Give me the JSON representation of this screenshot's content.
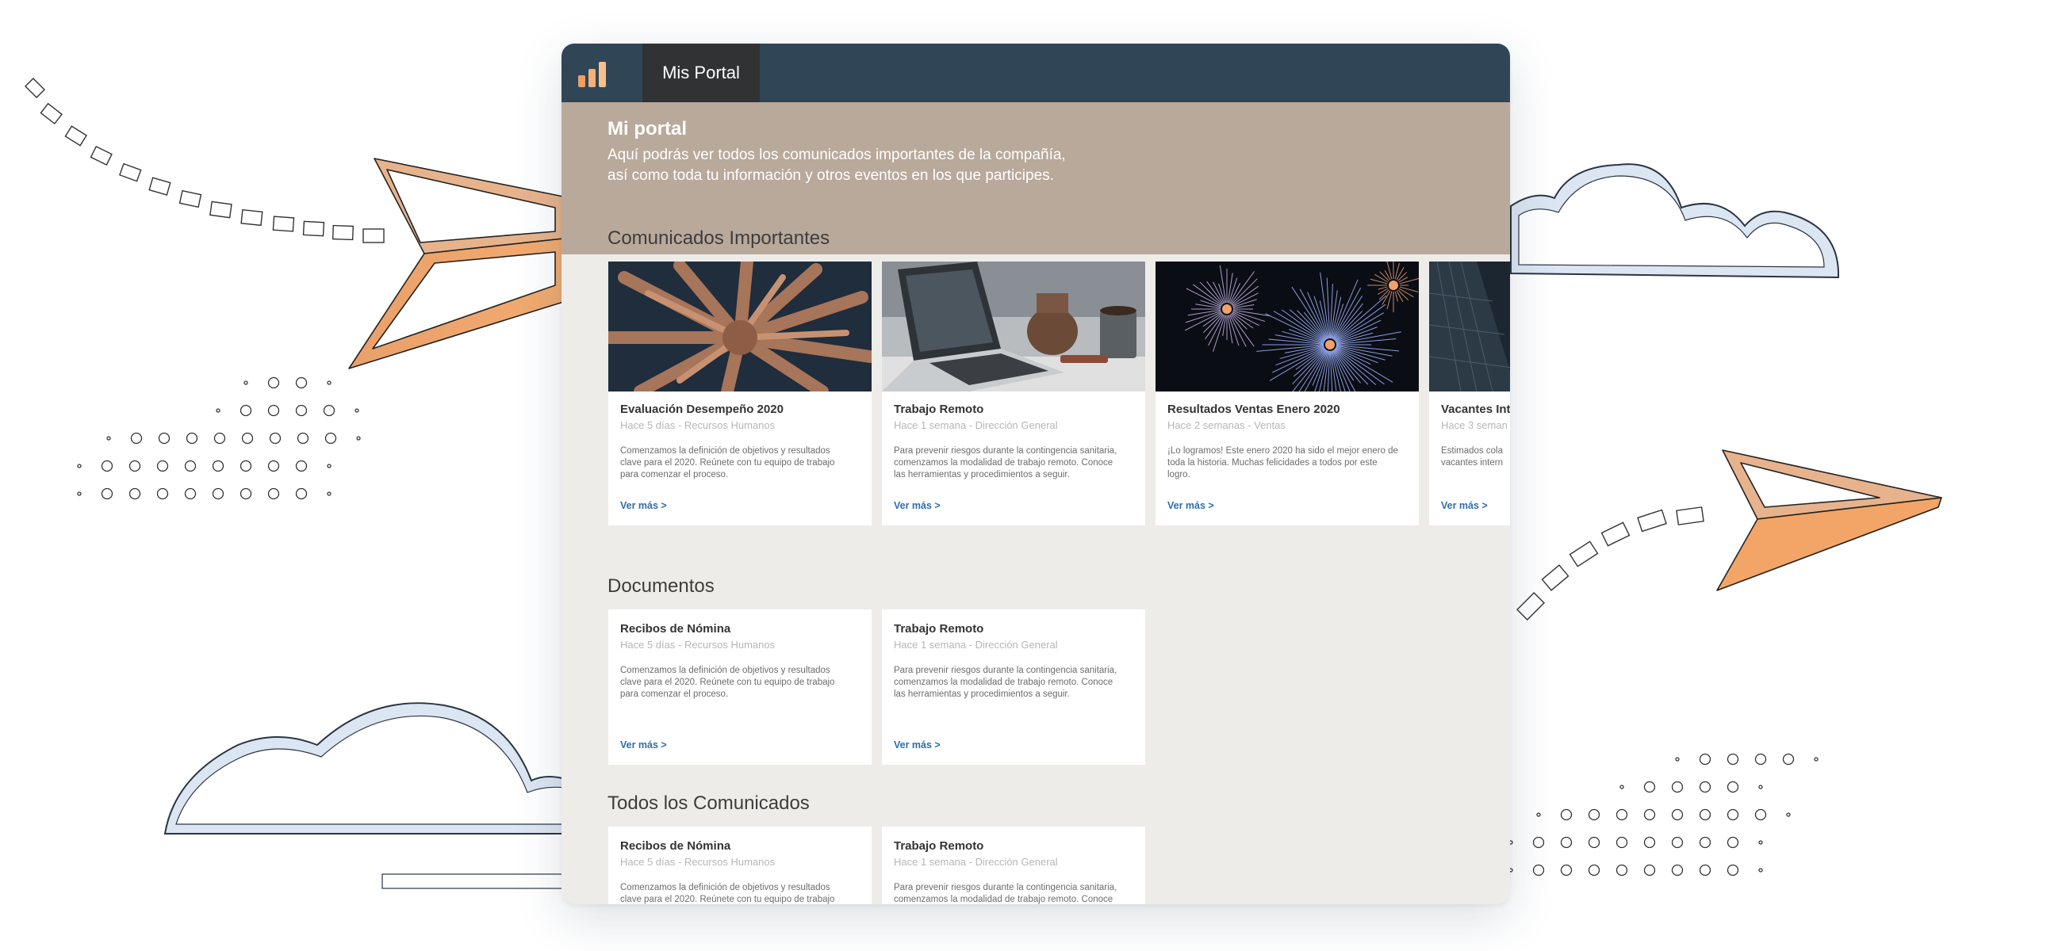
{
  "colors": {
    "topbar": "#304656",
    "tab_active": "#303234",
    "hero": "#b9a99b",
    "content_bg": "#eeece8",
    "link": "#2f6ea6",
    "accent_orange": "#f0a060"
  },
  "header": {
    "logo_icon": "bar-chart-logo-icon",
    "tab_label": "Mis Portal"
  },
  "hero": {
    "title": "Mi portal",
    "line1": "Aquí podrás ver todos los comunicados importantes de la compañía,",
    "line2": "así como toda tu información y otros eventos en los que participes."
  },
  "sections": {
    "important": {
      "title": "Comunicados Importantes",
      "cards": [
        {
          "image": "team-hands-photo",
          "title": "Evaluación Desempeño 2020",
          "meta": "Hace 5 días - Recursos Humanos",
          "desc": "Comenzamos la definición de objetivos y resultados clave para el 2020. Reúnete con tu equipo de trabajo para comenzar el proceso.",
          "link": "Ver más >"
        },
        {
          "image": "laptop-coffee-photo",
          "title": "Trabajo Remoto",
          "meta": "Hace 1 semana - Dirección General",
          "desc": "Para prevenir riesgos durante la contingencia sanitaria, comenzamos la modalidad de trabajo remoto. Conoce las herramientas y procedimientos a seguir.",
          "link": "Ver más >"
        },
        {
          "image": "fireworks-photo",
          "title": "Resultados Ventas Enero 2020",
          "meta": "Hace 2 semanas - Ventas",
          "desc": "¡Lo logramos! Este enero 2020 ha sido el mejor enero de toda la historia. Muchas felicidades a todos por este logro.",
          "link": "Ver más >"
        },
        {
          "image": "office-building-photo",
          "title": "Vacantes Int",
          "meta": "Hace 3 seman",
          "desc": "Estimados cola vacantes intern",
          "link": "Ver más >"
        }
      ]
    },
    "documents": {
      "title": "Documentos",
      "cards": [
        {
          "title": "Recibos de Nómina",
          "meta": "Hace 5 días - Recursos Humanos",
          "desc": "Comenzamos la definición de objetivos y resultados clave para el 2020. Reúnete con tu equipo de trabajo para comenzar el proceso.",
          "link": "Ver más >"
        },
        {
          "title": "Trabajo Remoto",
          "meta": "Hace 1 semana - Dirección General",
          "desc": "Para prevenir riesgos durante la contingencia sanitaria, comenzamos la modalidad de trabajo remoto. Conoce las herramientas y procedimientos a seguir.",
          "link": "Ver más >"
        }
      ]
    },
    "all": {
      "title": "Todos los Comunicados",
      "cards": [
        {
          "title": "Recibos de Nómina",
          "meta": "Hace 5 días - Recursos Humanos",
          "desc": "Comenzamos la definición de objetivos y resultados clave para el 2020. Reúnete con tu equipo de trabajo"
        },
        {
          "title": "Trabajo Remoto",
          "meta": "Hace 1 semana - Dirección General",
          "desc": "Para prevenir riesgos durante la contingencia sanitaria, comenzamos la modalidad de trabajo remoto. Conoce"
        }
      ]
    }
  }
}
